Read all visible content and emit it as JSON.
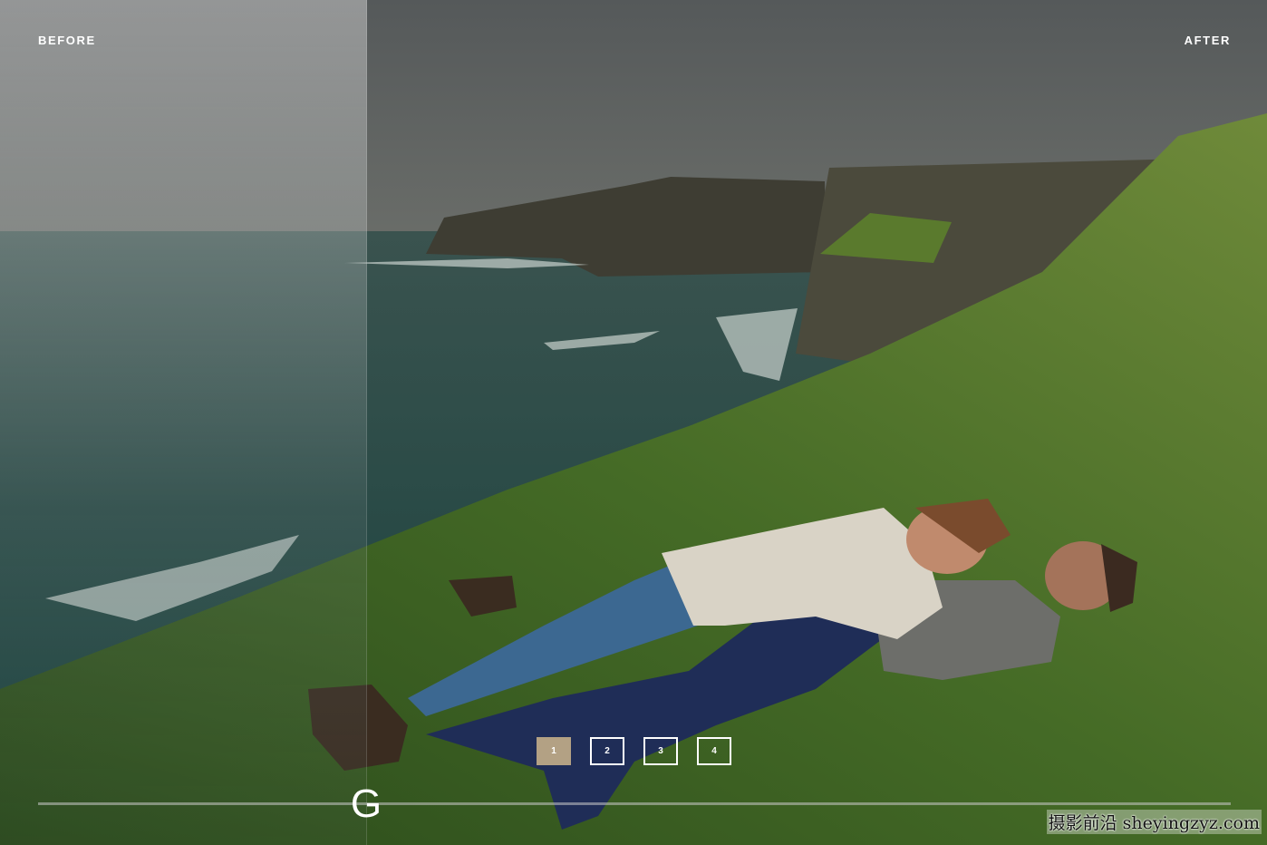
{
  "comparison": {
    "before_label": "BEFORE",
    "after_label": "AFTER",
    "handle_glyph": "G"
  },
  "pagination": {
    "pages": [
      "1",
      "2",
      "3",
      "4"
    ],
    "active_page": "1",
    "active_color": "#b3a184"
  },
  "watermark": {
    "text": "摄影前沿 sheyingzyz.com"
  },
  "colors": {
    "sky": "#5f625d",
    "sea": "#2e4f4c",
    "grass": "#3f6425",
    "cliff": "#4b4a3c"
  }
}
